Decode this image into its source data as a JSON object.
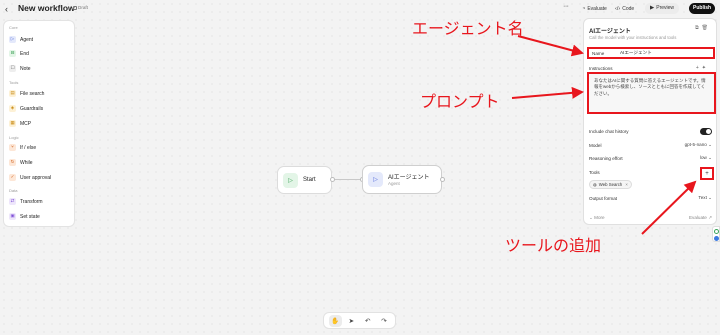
{
  "header": {
    "back_icon": "chevron-left-icon",
    "title": "New workflow",
    "draft_badge": "Draft",
    "more_label": "···",
    "evaluate_label": "Evaluate",
    "code_label": "Code",
    "preview_label": "Preview",
    "publish_label": "Publish"
  },
  "palette": {
    "sections": [
      {
        "title": "Core",
        "items": [
          {
            "label": "Agent",
            "icon": "agent-icon",
            "glyph": "▷",
            "color": "blue"
          },
          {
            "label": "End",
            "icon": "end-icon",
            "glyph": "⊟",
            "color": "green"
          },
          {
            "label": "Note",
            "icon": "note-icon",
            "glyph": "☐",
            "color": "gray"
          }
        ]
      },
      {
        "title": "Tools",
        "items": [
          {
            "label": "File search",
            "icon": "file-search-icon",
            "glyph": "▤",
            "color": "yellow"
          },
          {
            "label": "Guardrails",
            "icon": "guardrails-icon",
            "glyph": "◈",
            "color": "yellow"
          },
          {
            "label": "MCP",
            "icon": "mcp-icon",
            "glyph": "▦",
            "color": "yellow"
          }
        ]
      },
      {
        "title": "Logic",
        "items": [
          {
            "label": "If / else",
            "icon": "branch-icon",
            "glyph": "⑂",
            "color": "orange"
          },
          {
            "label": "While",
            "icon": "loop-icon",
            "glyph": "↻",
            "color": "orange"
          },
          {
            "label": "User approval",
            "icon": "approval-icon",
            "glyph": "✓",
            "color": "orange"
          }
        ]
      },
      {
        "title": "Data",
        "items": [
          {
            "label": "Transform",
            "icon": "transform-icon",
            "glyph": "⇄",
            "color": "purple"
          },
          {
            "label": "Set state",
            "icon": "state-icon",
            "glyph": "▣",
            "color": "purple"
          }
        ]
      }
    ]
  },
  "canvas": {
    "start_node": {
      "label": "Start",
      "icon": "play-icon"
    },
    "agent_node": {
      "label": "AIエージェント",
      "sublabel": "Agent",
      "icon": "agent-icon"
    }
  },
  "panel": {
    "title": "AIエージェント",
    "description": "Call the model with your instructions and tools",
    "header_icons": [
      "copy-icon",
      "trash-icon"
    ],
    "name_label": "Name",
    "name_value": "AIエージェント",
    "instructions_label": "Instructions",
    "instructions_text": "あなたはAIに関する質問に答えるエージェントです。情報をwebから検索し、ソースとともに回答を作成してください。",
    "include_chat_history_label": "Include chat history",
    "include_chat_history_on": true,
    "model_label": "Model",
    "model_value": "gpt-5-nano",
    "reasoning_label": "Reasoning effort",
    "reasoning_value": "low",
    "tools_label": "Tools",
    "tool_chip_label": "Web Search",
    "add_tool_label": "+",
    "output_format_label": "Output format",
    "output_format_value": "Text",
    "more_label": "More",
    "evaluate_label": "Evaluate"
  },
  "annotations": {
    "agent_name": "エージェント名",
    "prompt": "プロンプト",
    "add_tool": "ツールの追加",
    "color": "#e8161d"
  }
}
